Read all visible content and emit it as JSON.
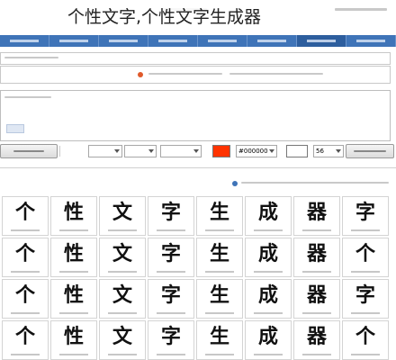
{
  "caption": {
    "text": "个性文字,个性文字生成器"
  },
  "nav": {
    "active_index": 6,
    "tab_count": 8
  },
  "toolbar": {
    "size_value": "56",
    "color_value": "#000000",
    "swatch_colors": [
      "#ff3300",
      "#ffffff"
    ]
  },
  "font_grid": {
    "glyphs": [
      "个",
      "性",
      "文",
      "字",
      "生",
      "成",
      "器",
      "字",
      "个",
      "性",
      "文",
      "字",
      "生",
      "成",
      "器",
      "个",
      "个",
      "性",
      "文",
      "字",
      "生",
      "成",
      "器",
      "字",
      "个",
      "性",
      "文",
      "字",
      "生",
      "成",
      "器",
      "个"
    ]
  },
  "colors": {
    "nav_bg": "#3f74b8",
    "nav_active": "#2d5e9e",
    "accent_red": "#ff3300"
  }
}
